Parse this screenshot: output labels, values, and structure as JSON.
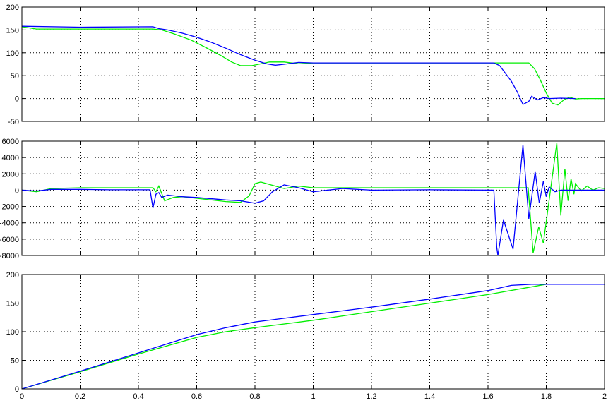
{
  "chart_data": [
    {
      "type": "line",
      "title": "",
      "xlim": [
        0,
        2
      ],
      "ylim": [
        -50,
        200
      ],
      "xticks": [
        "0",
        "0.2",
        "0.4",
        "0.6",
        "0.8",
        "1",
        "1.2",
        "1.4",
        "1.6",
        "1.8",
        "2"
      ],
      "yticks": [
        "-50",
        "0",
        "50",
        "100",
        "150",
        "200"
      ],
      "grid": true,
      "series": [
        {
          "name": "blue",
          "color": "#0000ff",
          "points": [
            [
              0,
              158
            ],
            [
              0.2,
              156
            ],
            [
              0.45,
              157
            ],
            [
              0.47,
              153
            ],
            [
              0.5,
              150
            ],
            [
              0.55,
              143
            ],
            [
              0.6,
              134
            ],
            [
              0.65,
              123
            ],
            [
              0.7,
              110
            ],
            [
              0.75,
              96
            ],
            [
              0.8,
              84
            ],
            [
              0.84,
              76
            ],
            [
              0.87,
              73
            ],
            [
              0.9,
              75
            ],
            [
              0.95,
              79
            ],
            [
              1.0,
              78
            ],
            [
              1.3,
              78
            ],
            [
              1.62,
              78
            ],
            [
              1.64,
              72
            ],
            [
              1.66,
              55
            ],
            [
              1.68,
              38
            ],
            [
              1.7,
              15
            ],
            [
              1.72,
              -13
            ],
            [
              1.74,
              -6
            ],
            [
              1.75,
              5
            ],
            [
              1.77,
              -3
            ],
            [
              1.79,
              2
            ],
            [
              1.81,
              0
            ],
            [
              1.85,
              1
            ],
            [
              1.9,
              0
            ]
          ]
        },
        {
          "name": "green",
          "color": "#00ee00",
          "points": [
            [
              0,
              157
            ],
            [
              0.05,
              152
            ],
            [
              0.45,
              152
            ],
            [
              0.48,
              150
            ],
            [
              0.52,
              142
            ],
            [
              0.58,
              128
            ],
            [
              0.63,
              112
            ],
            [
              0.68,
              95
            ],
            [
              0.72,
              80
            ],
            [
              0.75,
              72
            ],
            [
              0.79,
              72
            ],
            [
              0.82,
              76
            ],
            [
              0.85,
              80
            ],
            [
              0.9,
              80
            ],
            [
              0.95,
              76
            ],
            [
              1.0,
              78
            ],
            [
              1.3,
              78
            ],
            [
              1.74,
              78
            ],
            [
              1.76,
              65
            ],
            [
              1.78,
              40
            ],
            [
              1.8,
              12
            ],
            [
              1.82,
              -10
            ],
            [
              1.84,
              -14
            ],
            [
              1.86,
              -3
            ],
            [
              1.88,
              3
            ],
            [
              1.9,
              -1
            ],
            [
              1.92,
              0
            ],
            [
              2.0,
              0
            ]
          ]
        }
      ]
    },
    {
      "type": "line",
      "title": "",
      "xlim": [
        0,
        2
      ],
      "ylim": [
        -8000,
        6000
      ],
      "xticks": [
        "0",
        "0.2",
        "0.4",
        "0.6",
        "0.8",
        "1",
        "1.2",
        "1.4",
        "1.6",
        "1.8",
        "2"
      ],
      "yticks": [
        "-8000",
        "-6000",
        "-4000",
        "-2000",
        "0",
        "2000",
        "4000",
        "6000"
      ],
      "grid": true,
      "series": [
        {
          "name": "blue",
          "color": "#0000ff",
          "points": [
            [
              0,
              0
            ],
            [
              0.05,
              -100
            ],
            [
              0.1,
              100
            ],
            [
              0.2,
              100
            ],
            [
              0.3,
              50
            ],
            [
              0.44,
              50
            ],
            [
              0.45,
              -2200
            ],
            [
              0.46,
              -500
            ],
            [
              0.47,
              -300
            ],
            [
              0.48,
              -900
            ],
            [
              0.5,
              -600
            ],
            [
              0.55,
              -800
            ],
            [
              0.6,
              -900
            ],
            [
              0.7,
              -1200
            ],
            [
              0.75,
              -1300
            ],
            [
              0.8,
              -1600
            ],
            [
              0.83,
              -1300
            ],
            [
              0.86,
              -200
            ],
            [
              0.9,
              650
            ],
            [
              0.95,
              300
            ],
            [
              1.0,
              -200
            ],
            [
              1.1,
              200
            ],
            [
              1.2,
              0
            ],
            [
              1.4,
              50
            ],
            [
              1.62,
              0
            ],
            [
              1.63,
              -7000
            ],
            [
              1.634,
              -8000
            ],
            [
              1.653,
              -3650
            ],
            [
              1.686,
              -7230
            ],
            [
              1.72,
              5570
            ],
            [
              1.74,
              -3500
            ],
            [
              1.762,
              2300
            ],
            [
              1.776,
              -1600
            ],
            [
              1.79,
              1100
            ],
            [
              1.8,
              -800
            ],
            [
              1.81,
              400
            ],
            [
              1.83,
              -200
            ],
            [
              1.85,
              0
            ],
            [
              1.9,
              0
            ],
            [
              2.0,
              0
            ]
          ]
        },
        {
          "name": "green",
          "color": "#00ee00",
          "points": [
            [
              0,
              0
            ],
            [
              0.05,
              -200
            ],
            [
              0.1,
              200
            ],
            [
              0.2,
              300
            ],
            [
              0.45,
              300
            ],
            [
              0.46,
              -200
            ],
            [
              0.47,
              500
            ],
            [
              0.49,
              -1300
            ],
            [
              0.52,
              -900
            ],
            [
              0.55,
              -800
            ],
            [
              0.6,
              -1000
            ],
            [
              0.7,
              -1400
            ],
            [
              0.75,
              -1500
            ],
            [
              0.78,
              -700
            ],
            [
              0.8,
              800
            ],
            [
              0.82,
              1000
            ],
            [
              0.86,
              600
            ],
            [
              0.9,
              200
            ],
            [
              0.95,
              500
            ],
            [
              1.0,
              300
            ],
            [
              1.4,
              300
            ],
            [
              1.738,
              300
            ],
            [
              1.755,
              -7700
            ],
            [
              1.774,
              -4500
            ],
            [
              1.79,
              -6500
            ],
            [
              1.836,
              5770
            ],
            [
              1.85,
              -3100
            ],
            [
              1.864,
              2600
            ],
            [
              1.875,
              -1300
            ],
            [
              1.885,
              1400
            ],
            [
              1.895,
              -500
            ],
            [
              1.9,
              800
            ],
            [
              1.92,
              -100
            ],
            [
              1.94,
              500
            ],
            [
              1.96,
              0
            ],
            [
              1.98,
              300
            ],
            [
              2.0,
              200
            ]
          ]
        }
      ]
    },
    {
      "type": "line",
      "title": "",
      "xlim": [
        0,
        2
      ],
      "ylim": [
        0,
        200
      ],
      "xticks": [
        "0",
        "0.2",
        "0.4",
        "0.6",
        "0.8",
        "1",
        "1.2",
        "1.4",
        "1.6",
        "1.8",
        "2"
      ],
      "yticks": [
        "0",
        "50",
        "100",
        "150",
        "200"
      ],
      "grid": true,
      "series": [
        {
          "name": "blue",
          "color": "#0000ff",
          "points": [
            [
              0,
              0
            ],
            [
              0.2,
              31
            ],
            [
              0.4,
              63
            ],
            [
              0.6,
              95
            ],
            [
              0.7,
              107
            ],
            [
              0.8,
              117
            ],
            [
              1.0,
              130
            ],
            [
              1.2,
              143
            ],
            [
              1.4,
              157
            ],
            [
              1.6,
              172
            ],
            [
              1.68,
              181
            ],
            [
              1.75,
              183
            ],
            [
              2.0,
              183
            ]
          ]
        },
        {
          "name": "green",
          "color": "#00ee00",
          "points": [
            [
              0,
              0
            ],
            [
              0.2,
              30
            ],
            [
              0.4,
              61
            ],
            [
              0.6,
              90
            ],
            [
              0.7,
              100
            ],
            [
              0.8,
              107
            ],
            [
              1.0,
              120
            ],
            [
              1.2,
              135
            ],
            [
              1.4,
              150
            ],
            [
              1.6,
              165
            ],
            [
              1.8,
              183
            ],
            [
              2.0,
              183
            ]
          ]
        }
      ]
    }
  ]
}
